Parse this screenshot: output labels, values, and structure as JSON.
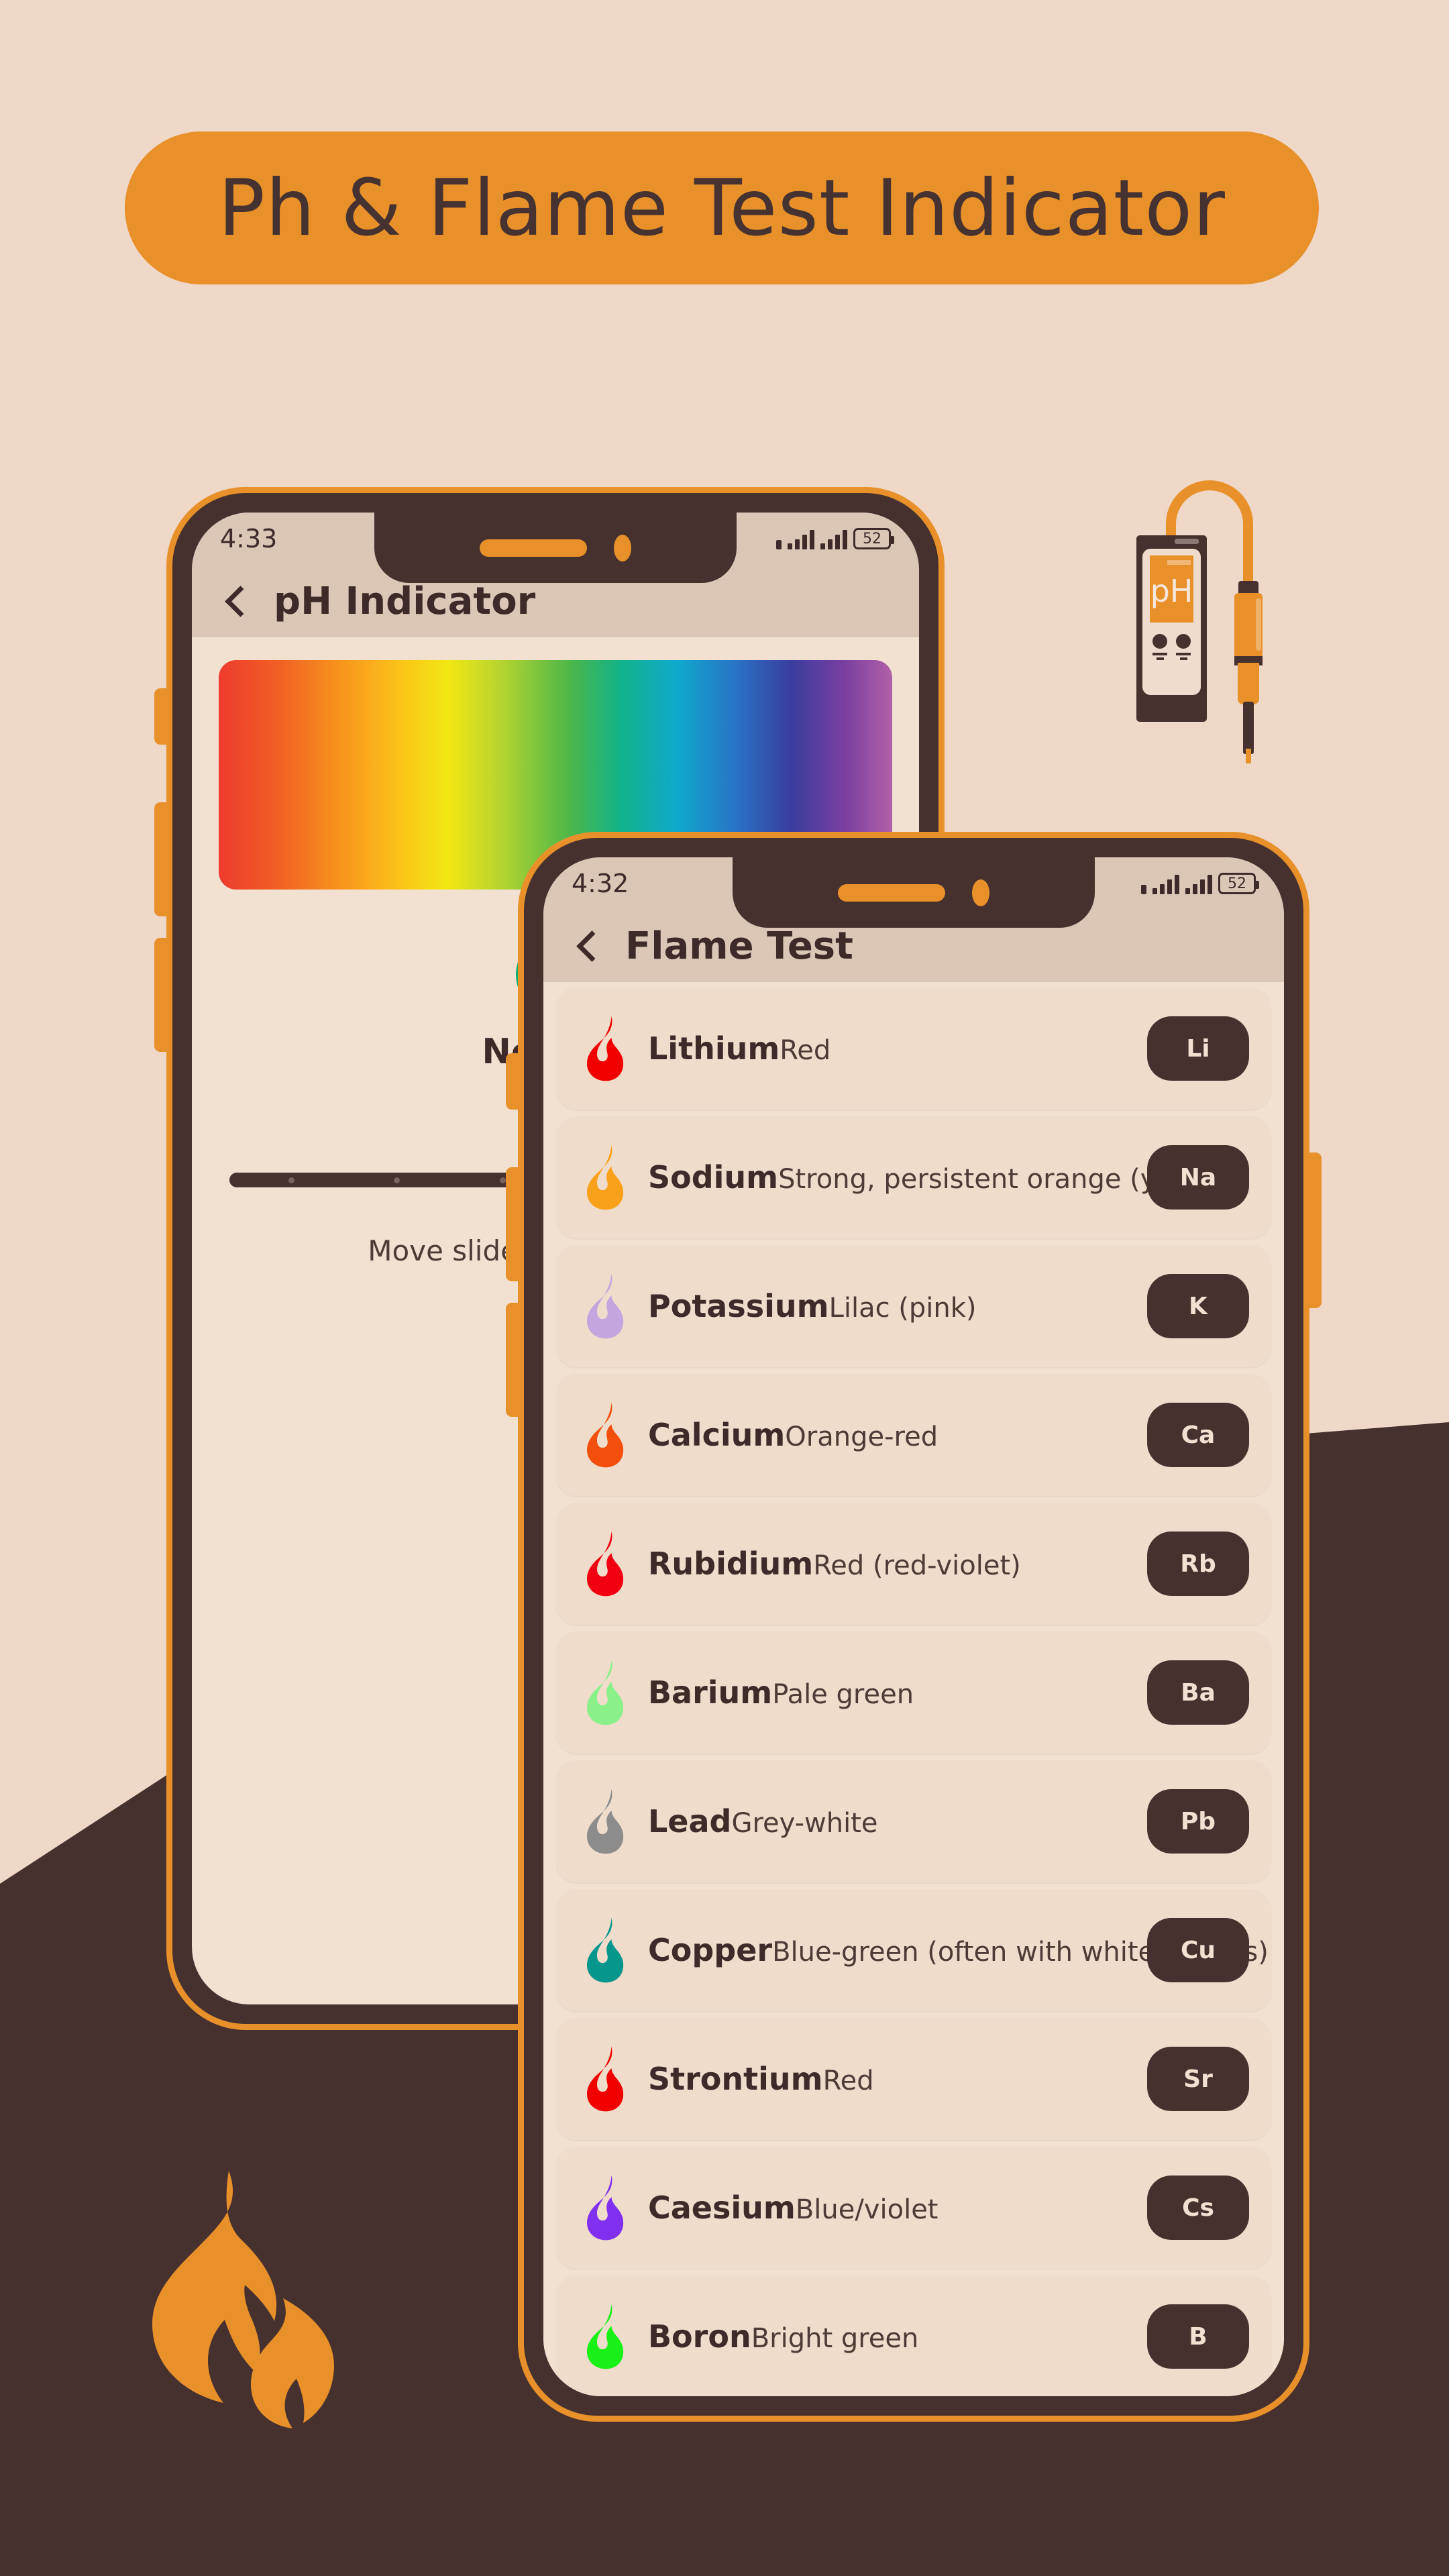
{
  "page": {
    "title": "Ph & Flame Test Indicator",
    "background_color": "#EFD8C7",
    "hill_color": "#47312F",
    "accent_color": "#E8912A",
    "dark_color": "#47312F"
  },
  "ph_meter": {
    "screen_label": "pH"
  },
  "phone_back": {
    "status": {
      "time": "4:33",
      "battery": "52"
    },
    "header": {
      "back_icon": "chevron-left-icon",
      "title": "pH Indicator"
    },
    "gradient_label": "pH color scale",
    "indicator_color": "#07B06B",
    "status_text": "Neutral",
    "slider_hint": "Move slider to match color"
  },
  "phone_front": {
    "status": {
      "time": "4:32",
      "battery": "52"
    },
    "header": {
      "back_icon": "chevron-left-icon",
      "title": "Flame Test"
    },
    "items": [
      {
        "name": "Lithium",
        "color_desc": "Red",
        "symbol": "Li",
        "flame_color": "#F20000"
      },
      {
        "name": "Sodium",
        "color_desc": "Strong, persistent orange (yellow)",
        "symbol": "Na",
        "flame_color": "#FAA11B"
      },
      {
        "name": "Potassium",
        "color_desc": "Lilac (pink)",
        "symbol": "K",
        "flame_color": "#C4A5DE"
      },
      {
        "name": "Calcium",
        "color_desc": "Orange-red",
        "symbol": "Ca",
        "flame_color": "#F44E0C"
      },
      {
        "name": "Rubidium",
        "color_desc": "Red (red-violet)",
        "symbol": "Rb",
        "flame_color": "#F20012"
      },
      {
        "name": "Barium",
        "color_desc": "Pale green",
        "symbol": "Ba",
        "flame_color": "#8AF08A"
      },
      {
        "name": "Lead",
        "color_desc": "Grey-white",
        "symbol": "Pb",
        "flame_color": "#8C8C8C"
      },
      {
        "name": "Copper",
        "color_desc": "Blue-green (often with white flashes)",
        "symbol": "Cu",
        "flame_color": "#06968C"
      },
      {
        "name": "Strontium",
        "color_desc": "Red",
        "symbol": "Sr",
        "flame_color": "#F20000"
      },
      {
        "name": "Caesium",
        "color_desc": "Blue/violet",
        "symbol": "Cs",
        "flame_color": "#8230F0"
      },
      {
        "name": "Boron",
        "color_desc": "Bright green",
        "symbol": "B",
        "flame_color": "#18F018"
      }
    ]
  }
}
